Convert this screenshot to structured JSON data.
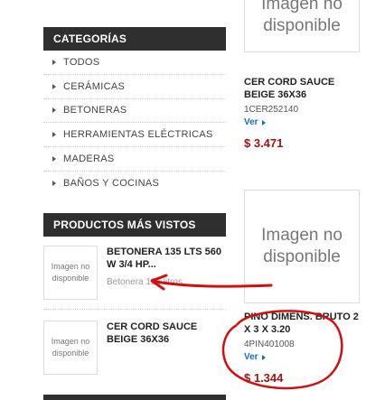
{
  "sidebar": {
    "categories_header": "CATEGORÍAS",
    "categories": [
      {
        "label": "TODOS"
      },
      {
        "label": "CERÁMICAS"
      },
      {
        "label": "BETONERAS"
      },
      {
        "label": "HERRAMIENTAS ELÉCTRICAS"
      },
      {
        "label": "MADERAS"
      },
      {
        "label": "BAÑOS Y COCINAS"
      }
    ],
    "most_viewed_header": "PRODUCTOS MÁS VISTOS",
    "most_viewed": [
      {
        "image_text": "Imagen no disponible",
        "title": "BETONERA 135 LTS 560 W 3/4 HP...",
        "subtitle": "Betonera 135 litros"
      },
      {
        "image_text": "Imagen no disponible",
        "title": "CER CORD SAUCE BEIGE 36X36",
        "subtitle": ""
      }
    ]
  },
  "products": [
    {
      "image_text": "Imagen no disponible",
      "title": "CER CORD SAUCE BEIGE 36X36",
      "code": "1CER252140",
      "view_label": "Ver",
      "price": "$ 3.471"
    },
    {
      "image_text": "Imagen no disponible",
      "title": "PINO DIMENS. BRUTO 2 X 3 X 3.20",
      "code": "4PIN401008",
      "view_label": "Ver",
      "price": "$ 1.344"
    }
  ],
  "colors": {
    "header_bg": "#2f2f2f",
    "price": "#a11212",
    "link": "#1a6eb5",
    "annotation": "#d01010"
  }
}
